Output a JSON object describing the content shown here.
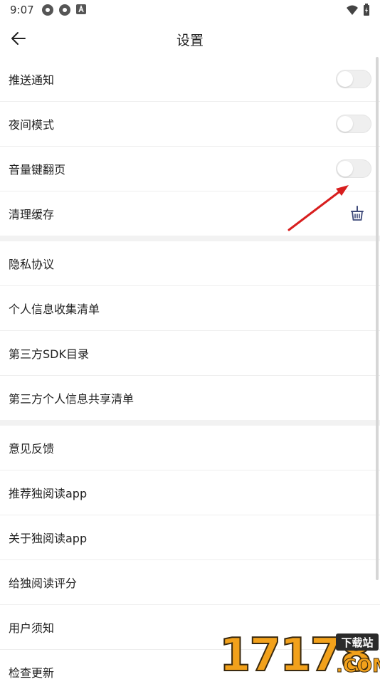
{
  "status": {
    "time": "9:07"
  },
  "header": {
    "title": "设置"
  },
  "groups": [
    {
      "items": [
        {
          "label": "推送通知",
          "control": "toggle",
          "on": false
        },
        {
          "label": "夜间模式",
          "control": "toggle",
          "on": false
        },
        {
          "label": "音量键翻页",
          "control": "toggle",
          "on": false
        },
        {
          "label": "清理缓存",
          "control": "clean-icon"
        }
      ]
    },
    {
      "items": [
        {
          "label": "隐私协议"
        },
        {
          "label": "个人信息收集清单"
        },
        {
          "label": "第三方SDK目录"
        },
        {
          "label": "第三方个人信息共享清单"
        }
      ]
    },
    {
      "items": [
        {
          "label": "意见反馈"
        },
        {
          "label": "推荐独阅读app"
        },
        {
          "label": "关于独阅读app"
        },
        {
          "label": "给独阅读评分"
        },
        {
          "label": "用户须知"
        },
        {
          "label": "检查更新"
        }
      ]
    }
  ],
  "watermark": {
    "text": "17178",
    "badge": "下载站",
    "suffix": ".COM"
  },
  "colors": {
    "annotation_arrow": "#d81e1e",
    "toggle_off": "#efefef",
    "divider": "#eeeeee",
    "group_gap": "#f2f2f2"
  }
}
